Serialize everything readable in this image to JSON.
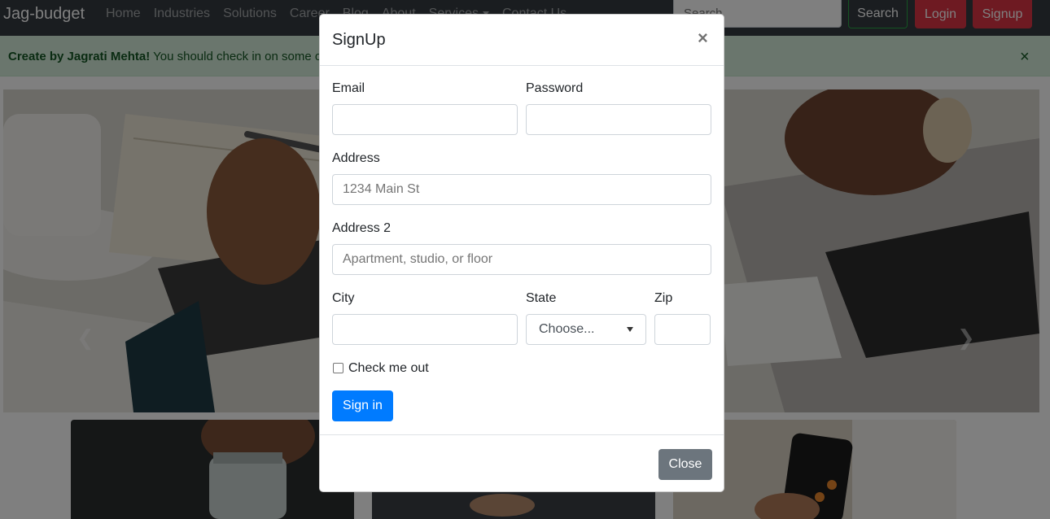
{
  "navbar": {
    "brand": "Jag-budget",
    "links": [
      "Home",
      "Industries",
      "Solutions",
      "Career",
      "Blog",
      "About",
      "Services",
      "Contact Us"
    ],
    "search_placeholder": "Search",
    "search_button": "Search",
    "login_button": "Login",
    "signup_button": "Signup"
  },
  "alert": {
    "strong": "Create by Jagrati Mehta!",
    "message": " You should check in on some of those fields below.",
    "close": "×",
    "color": "#d4edda"
  },
  "carousel": {
    "prev_icon": "chevron-left-icon",
    "next_icon": "chevron-right-icon"
  },
  "modal": {
    "title": "SignUp",
    "close_x": "×",
    "email_label": "Email",
    "password_label": "Password",
    "address_label": "Address",
    "address_placeholder": "1234 Main St",
    "address2_label": "Address 2",
    "address2_placeholder": "Apartment, studio, or floor",
    "city_label": "City",
    "state_label": "State",
    "state_selected": "Choose...",
    "zip_label": "Zip",
    "checkbox_label": "Check me out",
    "submit_button": "Sign in",
    "close_button": "Close"
  },
  "colors": {
    "navbar": "#343a40",
    "primary": "#007bff",
    "danger": "#dc3545",
    "success": "#28a745",
    "secondary": "#6c757d"
  }
}
